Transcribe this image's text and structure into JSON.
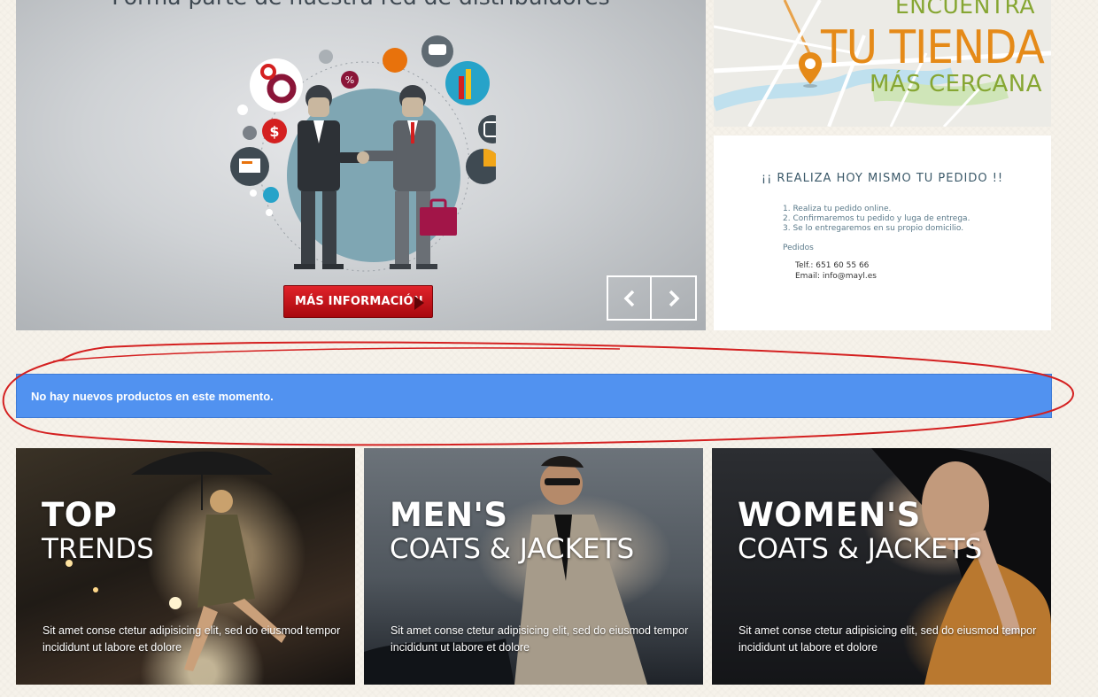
{
  "slider": {
    "title": "Forma parte de nuestra red de distribuidores",
    "more_info_label": "MÁS INFORMACIÓN",
    "prev_label": "‹",
    "next_label": "›"
  },
  "store_finder": {
    "line1": "ENCUENTRA",
    "line2": "TU TIENDA",
    "line3": "MÁS CERCANA"
  },
  "order_box": {
    "title": "¡¡ REALIZA HOY MISMO TU PEDIDO !!",
    "steps": [
      "1. Realiza tu pedido online.",
      "2. Confirmaremos tu pedido y luga de entrega.",
      "3. Se lo entregaremos en su propio domicilio."
    ],
    "pedidos_label": "Pedidos",
    "phone": "Telf.: 651 60 55 66",
    "email": "Email: info@mayl.es"
  },
  "alert": {
    "message": "No hay nuevos productos en este momento."
  },
  "banners": [
    {
      "heading": "TOP",
      "sub": "TRENDS",
      "text": "Sit amet conse ctetur adipisicing elit, sed do eiusmod tempor incididunt ut labore et dolore"
    },
    {
      "heading": "MEN'S",
      "sub": "COATS & JACKETS",
      "text": "Sit amet conse ctetur adipisicing elit, sed do eiusmod tempor incididunt ut labore et dolore"
    },
    {
      "heading": "WOMEN'S",
      "sub": "COATS & JACKETS",
      "text": "Sit amet conse ctetur adipisicing elit, sed do eiusmod tempor incididunt ut labore et dolore"
    }
  ],
  "colors": {
    "alert_bg": "#5192f0",
    "button_red": "#d0141b",
    "annotation_red": "#d42020",
    "brand_orange": "#e58a18",
    "brand_green": "#86a632"
  }
}
